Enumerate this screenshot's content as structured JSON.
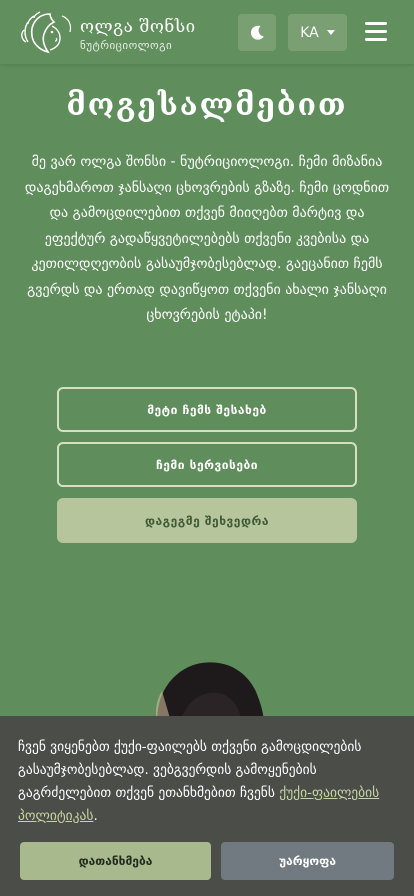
{
  "header": {
    "logo_title": "ოლგა შონსი",
    "logo_subtitle": "ნუტრიციოლოგი",
    "language": "KA",
    "icons": {
      "logo": "leaf-face-logo-icon",
      "theme": "moon-icon",
      "language_caret": "caret-down-icon",
      "menu": "hamburger-menu-icon"
    }
  },
  "hero": {
    "title": "მოგესალმებით",
    "intro": "მე ვარ ოლგა შონსი - ნუტრიციოლოგი. ჩემი მიზანია დაგეხმაროთ ჯანსაღი ცხოვრების გზაზე. ჩემი ცოდნით და გამოცდილებით თქვენ მიიღებთ მარტივ და ეფექტურ გადაწყვეტილებებს თქვენი კვებისა და კეთილდღეობის გასაუმჯობესებლად. გაეცანით ჩემს გვერდს და ერთად დავიწყოთ თქვენი ახალი ჯანსაღი ცხოვრების ეტაპი!",
    "buttons": {
      "about": "მეტი ჩემს შესახებ",
      "services": "ჩემი სერვისები",
      "book": "დაგეგმე შეხვედრა"
    }
  },
  "cookie": {
    "text": "ჩვენ ვიყენებთ ქუქი-ფაილებს თქვენი გამოცდილების გასაუმჯობესებლად. ვებგვერდის გამოყენების გაგრძელებით თქვენ ეთანხმებით ჩვენს",
    "link": "ქუქი-ფაილების პოლიტიკას",
    "period": ".",
    "accept": "დათანხმება",
    "reject": "უარყოფა"
  },
  "colors": {
    "background": "#5f8d5c",
    "button_filled": "#b6c59c",
    "cookie_bar": "#4a4d48",
    "accept": "#a8b98d",
    "reject": "#707a80"
  }
}
